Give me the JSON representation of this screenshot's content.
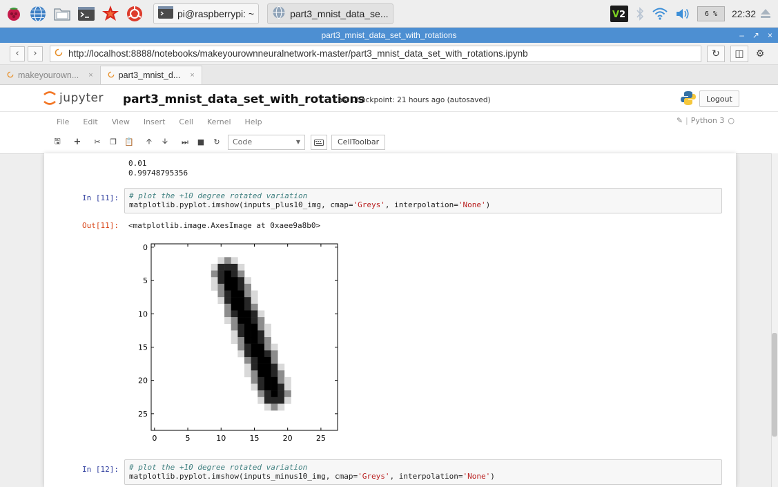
{
  "taskbar": {
    "launchers": [
      "raspberry-menu-icon",
      "globe-browser-icon",
      "file-manager-icon",
      "terminal-icon",
      "mathematica-icon",
      "wolfram-icon"
    ],
    "tasks": [
      {
        "label": "pi@raspberrypi: ~",
        "icon": "terminal-icon"
      },
      {
        "label": "part3_mnist_data_se...",
        "icon": "globe-browser-icon"
      }
    ],
    "cpu": "6 %",
    "clock": "22:32"
  },
  "window": {
    "title": "part3_mnist_data_set_with_rotations",
    "controls": [
      "–",
      "↗",
      "×"
    ]
  },
  "browser": {
    "url": "http://localhost:8888/notebooks/makeyourownneuralnetwork-master/part3_mnist_data_set_with_rotations.ipynb",
    "tabs": [
      {
        "label": "makeyourown...",
        "close": "×"
      },
      {
        "label": "part3_mnist_d...",
        "close": "×"
      }
    ]
  },
  "jupyter": {
    "logo_text": "jupyter",
    "notebook_name": "part3_mnist_data_set_with_rotations",
    "checkpoint": "Last Checkpoint: 21 hours ago (autosaved)",
    "logout_label": "Logout",
    "menu": [
      "File",
      "Edit",
      "View",
      "Insert",
      "Cell",
      "Kernel",
      "Help"
    ],
    "kernel": "Python 3",
    "cell_type": "Code",
    "celltoolbar_label": "CellToolbar"
  },
  "notebook": {
    "prev_output": [
      "0.01",
      "0.99748795356"
    ],
    "cell11": {
      "prompt_in": "In [11]:",
      "comment": "# plot the +10 degree rotated variation",
      "code_pre": "matplotlib.pyplot.imshow(inputs_plus10_img, cmap=",
      "code_str1": "'Greys'",
      "code_mid": ", interpolation=",
      "code_str2": "'None'",
      "code_post": ")",
      "prompt_out": "Out[11]:",
      "out_repr": "<matplotlib.image.AxesImage at 0xaee9a8b0>"
    },
    "cell12": {
      "prompt_in": "In [12]:",
      "comment": "# plot the +10 degree rotated variation",
      "code_pre": "matplotlib.pyplot.imshow(inputs_minus10_img, cmap=",
      "code_str1": "'Greys'",
      "code_mid": ", interpolation=",
      "code_str2": "'None'",
      "code_post": ")"
    }
  },
  "chart_data": {
    "type": "heatmap",
    "title": "",
    "xlabel": "",
    "ylabel": "",
    "xlim": [
      -0.5,
      27.5
    ],
    "ylim": [
      27.5,
      -0.5
    ],
    "xticks": [
      0,
      5,
      10,
      15,
      20,
      25
    ],
    "yticks": [
      0,
      5,
      10,
      15,
      20,
      25
    ],
    "colormap": "Greys",
    "description_of_values": "28x28 grayscale image of a handwritten digit 1 rotated +10 degrees; dark stroke runs from about (x=11,y=4) to (x=18,y=22)",
    "stroke": {
      "start": [
        11,
        4
      ],
      "end": [
        18,
        22
      ]
    }
  }
}
